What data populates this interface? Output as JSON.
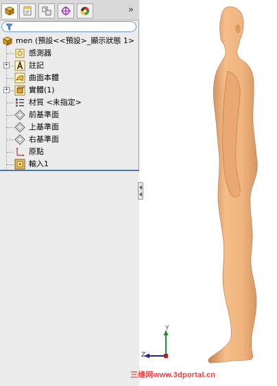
{
  "panel": {
    "tabs": [
      {
        "name": "tab-featuremanager",
        "icon": "featuremanager-tree-icon",
        "active": true
      },
      {
        "name": "tab-propertymanager",
        "icon": "propertymanager-icon",
        "active": false
      },
      {
        "name": "tab-configurationmanager",
        "icon": "configurationmanager-icon",
        "active": false
      },
      {
        "name": "tab-dimxpert",
        "icon": "dimxpert-target-icon",
        "active": false
      },
      {
        "name": "tab-displaymanager",
        "icon": "displaymanager-color-icon",
        "active": false
      }
    ],
    "expand_glyph": "»",
    "filter_icon": "filter-funnel-icon"
  },
  "tree": {
    "root_label": "men  (預設<<預設>_顯示狀態 1>",
    "items": [
      {
        "label": "感測器",
        "icon": "sensors-icon",
        "expandable": false
      },
      {
        "label": "註記",
        "icon": "annotations-icon",
        "expandable": true
      },
      {
        "label": "曲面本體",
        "icon": "surface-bodies-icon",
        "expandable": false
      },
      {
        "label": "實體(1)",
        "icon": "solid-bodies-icon",
        "expandable": true
      },
      {
        "label": "材質 <未指定>",
        "icon": "material-icon",
        "expandable": false
      },
      {
        "label": "前基準面",
        "icon": "plane-icon",
        "expandable": false
      },
      {
        "label": "上基準面",
        "icon": "plane-icon",
        "expandable": false
      },
      {
        "label": "右基準面",
        "icon": "plane-icon",
        "expandable": false
      },
      {
        "label": "原點",
        "icon": "origin-icon",
        "expandable": false
      },
      {
        "label": "輸入1",
        "icon": "imported-feature-icon",
        "expandable": false
      }
    ],
    "expander_glyph": "+"
  },
  "viewport": {
    "model_color": "#F0B47E",
    "triad": {
      "y_label": "Y",
      "z_label": "Z"
    }
  },
  "watermark": "三维网www.3dportal.cn",
  "colors": {
    "panel_bg": "#ECECEC",
    "accent_line": "#4B74A8",
    "watermark": "#FF3B3B"
  }
}
